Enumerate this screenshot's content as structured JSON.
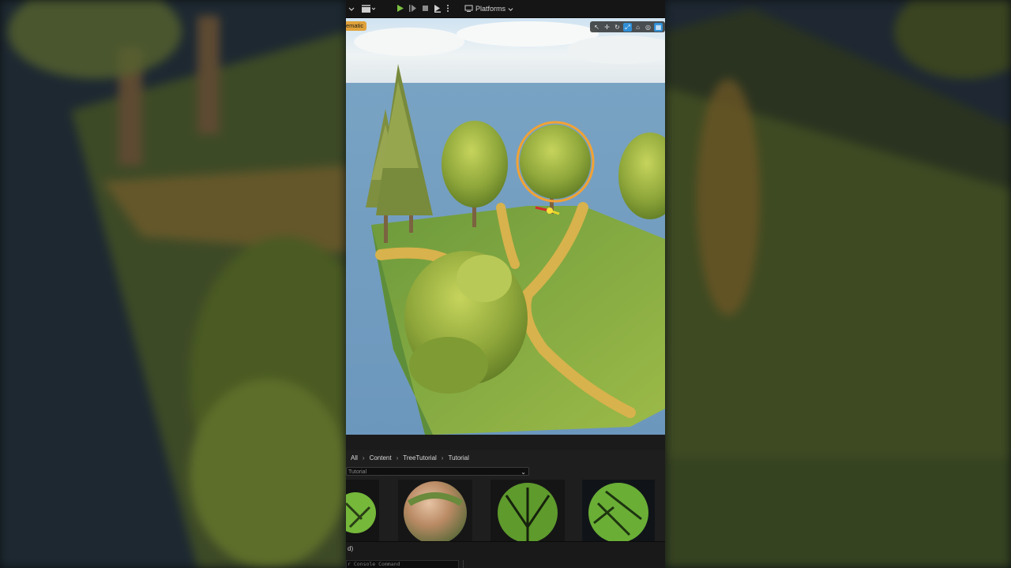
{
  "toolbar": {
    "platforms_label": "Platforms"
  },
  "viewport": {
    "cinematic_tag": "ematic",
    "tools": [
      "select-icon",
      "move-icon",
      "rotate-icon",
      "scale-icon",
      "camera-icon",
      "snap-icon",
      "grid-icon"
    ]
  },
  "content_browser": {
    "breadcrumb": [
      "All",
      "Content",
      "TreeTutorial",
      "Tutorial"
    ],
    "filter_value": "Tutorial",
    "assets": [
      {
        "kind": "leaf-texture",
        "selected": false
      },
      {
        "kind": "ground-material",
        "selected": false
      },
      {
        "kind": "leaf-texture",
        "selected": false
      },
      {
        "kind": "leaf-texture",
        "selected": true
      }
    ]
  },
  "statusbar": {
    "console_placeholder": "r Console Command",
    "output_glyph": "d)"
  },
  "colors": {
    "accent_blue": "#3d8fe0",
    "play_green": "#7cc142",
    "selection_orange": "#e0a23a"
  }
}
